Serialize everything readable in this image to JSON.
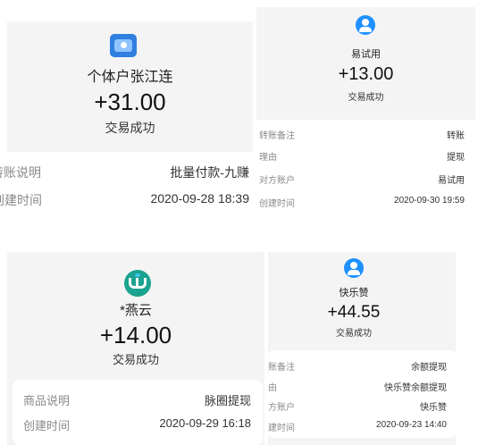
{
  "receipt1": {
    "name": "个体户张江连",
    "amount": "+31.00",
    "status": "交易成功",
    "rows": [
      {
        "label": "转账说明",
        "value": "批量付款-九赚"
      },
      {
        "label": "创建时间",
        "value": "2020-09-28 18:39"
      }
    ]
  },
  "receipt2": {
    "name": "易试用",
    "amount": "+13.00",
    "status": "交易成功",
    "rows": [
      {
        "label": "转账备注",
        "value": "转账"
      },
      {
        "label": "理由",
        "value": "提现"
      },
      {
        "label": "对方账户",
        "value": "易试用"
      },
      {
        "label": "创建时间",
        "value": "2020-09-30 19:59"
      }
    ]
  },
  "receipt3": {
    "name": "*燕云",
    "amount": "+14.00",
    "status": "交易成功",
    "rows": [
      {
        "label": "商品说明",
        "value": "脉圈提现"
      },
      {
        "label": "创建时间",
        "value": "2020-09-29 16:18"
      }
    ]
  },
  "receipt4": {
    "name": "快乐赞",
    "amount": "+44.55",
    "status": "交易成功",
    "rows": [
      {
        "label": "账备注",
        "value": "余额提现"
      },
      {
        "label": "由",
        "value": "快乐赞余额提现"
      },
      {
        "label": "方账户",
        "value": "快乐赞"
      },
      {
        "label": "建时间",
        "value": "2020-09-23 14:40"
      }
    ]
  },
  "colors": {
    "accent": "#1e90ff",
    "card": "#f4f4f4",
    "label": "#8a8a8a"
  }
}
